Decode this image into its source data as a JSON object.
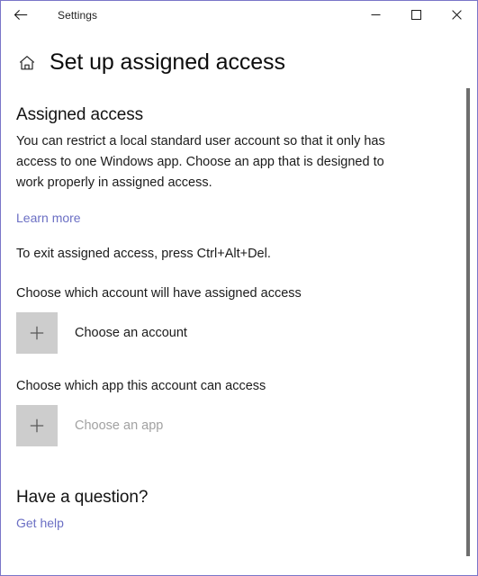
{
  "titlebar": {
    "back_icon": "back-arrow-icon",
    "title": "Settings",
    "minimize_icon": "minimize-icon",
    "maximize_icon": "maximize-icon",
    "close_icon": "close-icon"
  },
  "header": {
    "home_icon": "home-icon",
    "title": "Set up assigned access"
  },
  "main": {
    "section_heading": "Assigned access",
    "description": "You can restrict a local standard user account so that it only has access to one Windows app. Choose an app that is designed to work properly in assigned access.",
    "learn_more_label": "Learn more",
    "exit_hint": "To exit assigned access, press Ctrl+Alt+Del.",
    "account_picker": {
      "label": "Choose which account will have assigned access",
      "tile_icon": "plus-icon",
      "text": "Choose an account",
      "disabled": false
    },
    "app_picker": {
      "label": "Choose which app this account can access",
      "tile_icon": "plus-icon",
      "text": "Choose an app",
      "disabled": true
    }
  },
  "footer": {
    "heading": "Have a question?",
    "get_help_label": "Get help"
  },
  "colors": {
    "window_border": "#7a75c8",
    "link": "#6b6fc4",
    "tile_background": "#cdcdcd",
    "disabled_text": "#a2a2a2",
    "scrollbar_thumb": "#6e6e6e"
  }
}
